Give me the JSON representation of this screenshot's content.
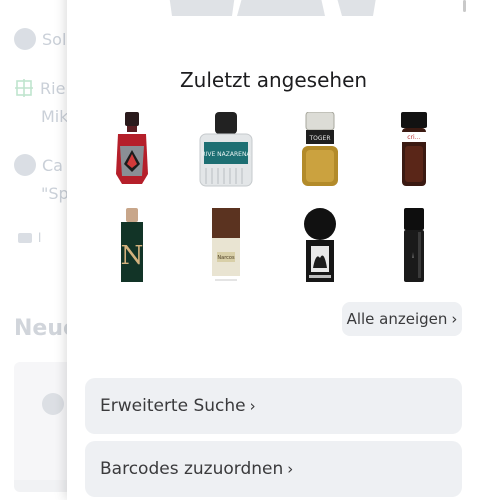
{
  "background": {
    "row1": {
      "text": "Sol"
    },
    "row2": {
      "line1": "Rie",
      "line2": "Mik"
    },
    "row3": {
      "line1": "Ca",
      "line2": "\"Sp"
    },
    "row4": {
      "text": "l"
    },
    "heading": "Neue"
  },
  "recently_viewed": {
    "title": "Zuletzt angesehen",
    "products": [
      {
        "icon": "red-perfume-bottle-icon"
      },
      {
        "icon": "teal-label-bottle-icon",
        "label": "RIVE NAZARENA"
      },
      {
        "icon": "gold-bottle-black-cap-icon",
        "label": "TOGER"
      },
      {
        "icon": "dark-attar-bottle-icon",
        "label": "cri…"
      },
      {
        "icon": "green-n-bottle-icon",
        "label": "N"
      },
      {
        "icon": "brown-cap-bottle-icon",
        "label": "Narcos"
      },
      {
        "icon": "black-sphere-bottle-icon"
      },
      {
        "icon": "black-cylinder-bottle-icon"
      }
    ],
    "show_all_label": "Alle anzeigen"
  },
  "actions": {
    "advanced_search": "Erweiterte Suche",
    "assign_barcodes": "Barcodes zuzuordnen"
  },
  "colors": {
    "button_bg": "#eef0f3",
    "text_dark": "#1d1d1f",
    "bg_muted_text": "#aeb7c4"
  }
}
